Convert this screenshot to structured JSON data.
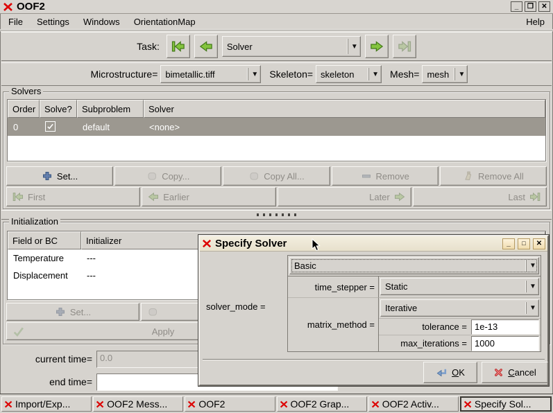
{
  "window": {
    "title": "OOF2"
  },
  "icons": {
    "combo_arrow": "▼",
    "minimize": "_",
    "maximize": "❐",
    "close": "✕"
  },
  "menubar": {
    "items": [
      "File",
      "Settings",
      "Windows",
      "OrientationMap"
    ],
    "help": "Help"
  },
  "task_nav": {
    "label": "Task:",
    "selector_value": "Solver"
  },
  "context_bar": {
    "microstructure_label": "Microstructure=",
    "microstructure_value": "bimetallic.tiff",
    "skeleton_label": "Skeleton=",
    "skeleton_value": "skeleton",
    "mesh_label": "Mesh=",
    "mesh_value": "mesh"
  },
  "solvers": {
    "frame_label": "Solvers",
    "columns": [
      "Order",
      "Solve?",
      "Subproblem",
      "Solver"
    ],
    "rows": [
      {
        "order": "0",
        "solve_checked": true,
        "subproblem": "default",
        "solver": "<none>"
      }
    ],
    "buttons": {
      "set": "Set...",
      "copy": "Copy...",
      "copy_all": "Copy All...",
      "remove": "Remove",
      "remove_all": "Remove All"
    },
    "nav": {
      "first": "First",
      "earlier": "Earlier",
      "later": "Later",
      "last": "Last"
    }
  },
  "initialization": {
    "frame_label": "Initialization",
    "columns": [
      "Field or BC",
      "Initializer"
    ],
    "rows": [
      {
        "field": "Temperature",
        "initializer": "---"
      },
      {
        "field": "Displacement",
        "initializer": "---"
      }
    ],
    "buttons": {
      "set": "Set...",
      "apply": "Apply"
    }
  },
  "time": {
    "current_label": "current time=",
    "current_value": "0.0",
    "end_label": "end time=",
    "end_value": ""
  },
  "dialog": {
    "title": "Specify Solver",
    "solver_mode_label": "solver_mode =",
    "mode_value": "Basic",
    "time_stepper_label": "time_stepper =",
    "time_stepper_value": "Static",
    "matrix_method_label": "matrix_method =",
    "matrix_method_value": "Iterative",
    "tolerance_label": "tolerance =",
    "tolerance_value": "1e-13",
    "max_iterations_label": "max_iterations =",
    "max_iterations_value": "1000",
    "ok_initial": "O",
    "ok_rest": "K",
    "cancel_initial": "C",
    "cancel_rest": "ancel"
  },
  "taskbar": {
    "items": [
      {
        "label": "Import/Exp..."
      },
      {
        "label": "OOF2 Mess..."
      },
      {
        "label": "OOF2"
      },
      {
        "label": "OOF2 Grap..."
      },
      {
        "label": "OOF2 Activ..."
      },
      {
        "label": "Specify Sol..."
      }
    ]
  },
  "colors": {
    "background": "#d6d3ce",
    "selection": "#9c9890",
    "arrow_green": "#84c43e",
    "plus_blue": "#647fad",
    "logo_red": "#dd0000",
    "dialog_titlebar": "#f3eedf"
  }
}
